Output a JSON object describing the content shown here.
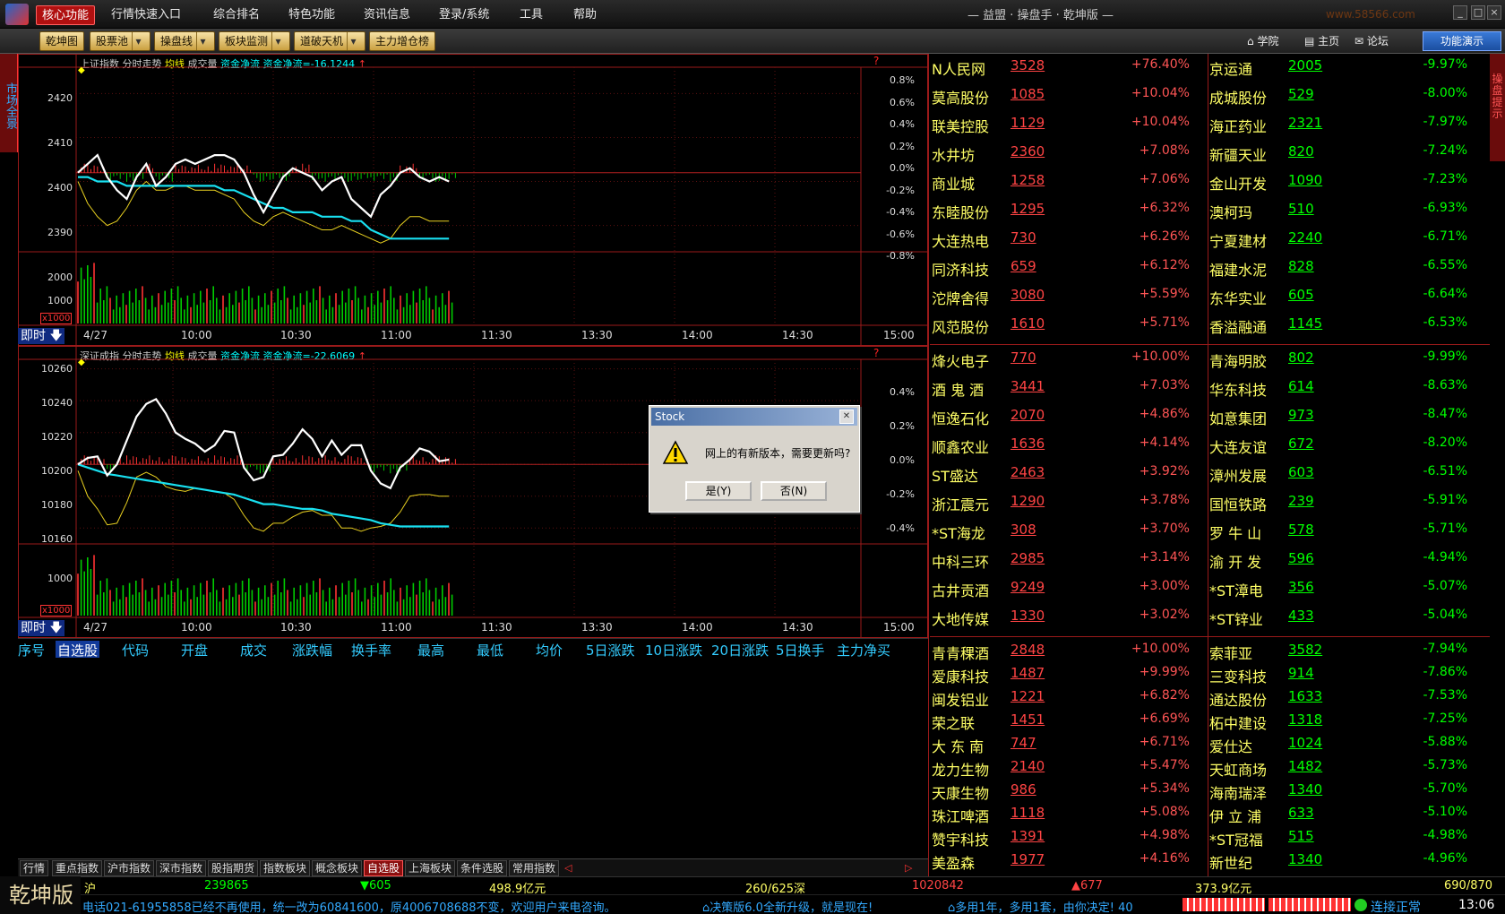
{
  "menubar": {
    "items": [
      "核心功能",
      "行情快速入口",
      "综合排名",
      "特色功能",
      "资讯信息",
      "登录/系统",
      "工具",
      "帮助"
    ],
    "brand": "— 益盟 · 操盘手 · 乾坤版 —",
    "sitemark": "www.58566.com"
  },
  "toolbar": {
    "buttons": [
      "乾坤图",
      "股票池",
      "操盘线",
      "板块监测",
      "道破天机",
      "主力增仓榜"
    ],
    "links": [
      "学院",
      "主页",
      "论坛"
    ],
    "demo": "功能演示"
  },
  "lefttab": "市场全景",
  "rightside": "操盘提示",
  "chart1": {
    "title_name": "上证指数",
    "labels": [
      "分时走势",
      "均线",
      "成交量",
      "资金净流"
    ],
    "flow": "资金净流=-16.1244",
    "yticks": [
      "2420",
      "2410",
      "2400",
      "2390"
    ],
    "pticks": [
      "0.8%",
      "0.6%",
      "0.4%",
      "0.2%",
      "0.0%",
      "-0.2%",
      "-0.4%",
      "-0.6%",
      "-0.8%"
    ],
    "vticks": [
      "2000",
      "1000"
    ],
    "unit": "x1000",
    "date": "4/27",
    "times": [
      "10:00",
      "10:30",
      "11:00",
      "11:30",
      "13:30",
      "14:00",
      "14:30",
      "15:00"
    ]
  },
  "chart2": {
    "title_name": "深证成指",
    "labels": [
      "分时走势",
      "均线",
      "成交量",
      "资金净流"
    ],
    "flow": "资金净流=-22.6069",
    "yticks": [
      "10260",
      "10240",
      "10220",
      "10200",
      "10180",
      "10160"
    ],
    "pticks": [
      "0.4%",
      "0.2%",
      "0.0%",
      "-0.2%",
      "-0.4%"
    ],
    "vticks": [
      "1000"
    ],
    "unit": "x1000",
    "date": "4/27",
    "times": [
      "10:00",
      "10:30",
      "11:00",
      "11:30",
      "13:30",
      "14:00",
      "14:30",
      "15:00"
    ]
  },
  "jishi": "即时",
  "columns": [
    "序号",
    "自选股",
    "代码",
    "开盘",
    "成交",
    "涨跌幅",
    "换手率",
    "最高",
    "最低",
    "均价",
    "5日涨跌",
    "10日涨跌",
    "20日涨跌",
    "5日换手",
    "主力净买"
  ],
  "lists": [
    [
      {
        "a": "N人民网",
        "ap": "3528",
        "ac": "+76.40%",
        "b": "京运通",
        "bp": "2005",
        "bc": "-9.97%"
      },
      {
        "a": "莫高股份",
        "ap": "1085",
        "ac": "+10.04%",
        "b": "成城股份",
        "bp": "529",
        "bc": "-8.00%"
      },
      {
        "a": "联美控股",
        "ap": "1129",
        "ac": "+10.04%",
        "b": "海正药业",
        "bp": "2321",
        "bc": "-7.97%"
      },
      {
        "a": "水井坊",
        "ap": "2360",
        "ac": "+7.08%",
        "b": "新疆天业",
        "bp": "820",
        "bc": "-7.24%"
      },
      {
        "a": "商业城",
        "ap": "1258",
        "ac": "+7.06%",
        "b": "金山开发",
        "bp": "1090",
        "bc": "-7.23%"
      },
      {
        "a": "东睦股份",
        "ap": "1295",
        "ac": "+6.32%",
        "b": "澳柯玛",
        "bp": "510",
        "bc": "-6.93%"
      },
      {
        "a": "大连热电",
        "ap": "730",
        "ac": "+6.26%",
        "b": "宁夏建材",
        "bp": "2240",
        "bc": "-6.71%"
      },
      {
        "a": "同济科技",
        "ap": "659",
        "ac": "+6.12%",
        "b": "福建水泥",
        "bp": "828",
        "bc": "-6.55%"
      },
      {
        "a": "沱牌舍得",
        "ap": "3080",
        "ac": "+5.59%",
        "b": "东华实业",
        "bp": "605",
        "bc": "-6.64%"
      },
      {
        "a": "风范股份",
        "ap": "1610",
        "ac": "+5.71%",
        "b": "香溢融通",
        "bp": "1145",
        "bc": "-6.53%"
      }
    ],
    [
      {
        "a": "烽火电子",
        "ap": "770",
        "ac": "+10.00%",
        "b": "青海明胶",
        "bp": "802",
        "bc": "-9.99%"
      },
      {
        "a": "酒 鬼 酒",
        "ap": "3441",
        "ac": "+7.03%",
        "b": "华东科技",
        "bp": "614",
        "bc": "-8.63%"
      },
      {
        "a": "恒逸石化",
        "ap": "2070",
        "ac": "+4.86%",
        "b": "如意集团",
        "bp": "973",
        "bc": "-8.47%"
      },
      {
        "a": "顺鑫农业",
        "ap": "1636",
        "ac": "+4.14%",
        "b": "大连友谊",
        "bp": "672",
        "bc": "-8.20%"
      },
      {
        "a": "ST盛达",
        "ap": "2463",
        "ac": "+3.92%",
        "b": "漳州发展",
        "bp": "603",
        "bc": "-6.51%"
      },
      {
        "a": "浙江震元",
        "ap": "1290",
        "ac": "+3.78%",
        "b": "国恒铁路",
        "bp": "239",
        "bc": "-5.91%"
      },
      {
        "a": "*ST海龙",
        "ap": "308",
        "ac": "+3.70%",
        "b": "罗 牛 山",
        "bp": "578",
        "bc": "-5.71%"
      },
      {
        "a": "中科三环",
        "ap": "2985",
        "ac": "+3.14%",
        "b": "渝 开 发",
        "bp": "596",
        "bc": "-4.94%"
      },
      {
        "a": "古井贡酒",
        "ap": "9249",
        "ac": "+3.00%",
        "b": "*ST漳电",
        "bp": "356",
        "bc": "-5.07%"
      },
      {
        "a": "大地传媒",
        "ap": "1330",
        "ac": "+3.02%",
        "b": "*ST锌业",
        "bp": "433",
        "bc": "-5.04%"
      }
    ],
    [
      {
        "a": "青青稞酒",
        "ap": "2848",
        "ac": "+10.00%",
        "b": "索菲亚",
        "bp": "3582",
        "bc": "-7.94%"
      },
      {
        "a": "爱康科技",
        "ap": "1487",
        "ac": "+9.99%",
        "b": "三变科技",
        "bp": "914",
        "bc": "-7.86%"
      },
      {
        "a": "闽发铝业",
        "ap": "1221",
        "ac": "+6.82%",
        "b": "通达股份",
        "bp": "1633",
        "bc": "-7.53%"
      },
      {
        "a": "荣之联",
        "ap": "1451",
        "ac": "+6.69%",
        "b": "柘中建设",
        "bp": "1318",
        "bc": "-7.25%"
      },
      {
        "a": "大 东 南",
        "ap": "747",
        "ac": "+6.71%",
        "b": "爱仕达",
        "bp": "1024",
        "bc": "-5.88%"
      },
      {
        "a": "龙力生物",
        "ap": "2140",
        "ac": "+5.47%",
        "b": "天虹商场",
        "bp": "1482",
        "bc": "-5.73%"
      },
      {
        "a": "天康生物",
        "ap": "986",
        "ac": "+5.34%",
        "b": "海南瑞泽",
        "bp": "1340",
        "bc": "-5.70%"
      },
      {
        "a": "珠江啤酒",
        "ap": "1118",
        "ac": "+5.08%",
        "b": "伊 立 浦",
        "bp": "633",
        "bc": "-5.10%"
      },
      {
        "a": "赞宇科技",
        "ap": "1391",
        "ac": "+4.98%",
        "b": "*ST冠福",
        "bp": "515",
        "bc": "-4.98%"
      },
      {
        "a": "美盈森",
        "ap": "1977",
        "ac": "+4.16%",
        "b": "新世纪",
        "bp": "1340",
        "bc": "-4.96%"
      }
    ]
  ],
  "btabs": [
    "行情",
    "重点指数",
    "沪市指数",
    "深市指数",
    "股指期货",
    "指数板块",
    "概念板块",
    "自选股",
    "上海板块",
    "条件选股",
    "常用指数"
  ],
  "status": {
    "brand": "乾坤版",
    "sh_label": "沪",
    "sh_index": "239865",
    "sh_change": "▼605",
    "sh_amount": "498.9亿元",
    "sh_ratio": "260/625深",
    "sz_index": "1020842",
    "sz_change": "▲677",
    "sz_amount": "373.9亿元",
    "sz_ratio": "690/870",
    "ticker": "电话021-61955858已经不再使用，统一改为60841600，原4006708688不变，欢迎用户来电咨询。",
    "ticker2": "决策版6.0全新升级，就是现在!",
    "ticker3": "多用1年，多用1套，由你决定! 40",
    "conn": "连接正常",
    "time": "13:06"
  },
  "dialog": {
    "title": "Stock",
    "message": "网上的有新版本，需要更新吗?",
    "yes": "是(Y)",
    "no": "否(N)"
  },
  "chart_data": [
    {
      "type": "line",
      "title": "上证指数",
      "yticks": [
        2420,
        2410,
        2400,
        2390
      ],
      "ylim": [
        2384,
        2426
      ],
      "price": [
        2402,
        2404,
        2406,
        2401,
        2398,
        2396,
        2401,
        2404,
        2399,
        2401,
        2404,
        2405,
        2404,
        2405,
        2406,
        2406,
        2405,
        2402,
        2397,
        2393,
        2397,
        2401,
        2403,
        2402,
        2401,
        2398,
        2400,
        2401,
        2396,
        2394,
        2392,
        2397,
        2399,
        2402,
        2403,
        2401,
        2400,
        2401,
        2400
      ],
      "avg": [
        2401,
        2401,
        2400,
        2400,
        2400,
        2399,
        2399,
        2399,
        2399,
        2399,
        2399,
        2399,
        2399,
        2399,
        2399,
        2398,
        2398,
        2397,
        2396,
        2395,
        2394,
        2394,
        2393,
        2393,
        2393,
        2392,
        2392,
        2392,
        2391,
        2391,
        2389,
        2388,
        2387,
        2387,
        2387,
        2387,
        2387,
        2387,
        2387
      ],
      "flow": [
        2400,
        2395,
        2392,
        2390,
        2391,
        2394,
        2398,
        2400,
        2398,
        2398,
        2399,
        2399,
        2398,
        2398,
        2398,
        2397,
        2396,
        2393,
        2391,
        2390,
        2392,
        2393,
        2392,
        2391,
        2390,
        2389,
        2389,
        2390,
        2389,
        2388,
        2387,
        2386,
        2387,
        2390,
        2392,
        2392,
        2391,
        2391,
        2391
      ]
    },
    {
      "type": "line",
      "title": "深证成指",
      "yticks": [
        10260,
        10240,
        10220,
        10200,
        10180,
        10160
      ],
      "ylim": [
        10150,
        10266
      ],
      "price": [
        10200,
        10204,
        10205,
        10193,
        10200,
        10215,
        10230,
        10238,
        10241,
        10232,
        10220,
        10216,
        10213,
        10208,
        10212,
        10221,
        10220,
        10198,
        10190,
        10192,
        10205,
        10206,
        10213,
        10222,
        10216,
        10205,
        10215,
        10206,
        10212,
        10212,
        10196,
        10188,
        10185,
        10198,
        10203,
        10210,
        10208,
        10202,
        10203
      ],
      "avg": [
        10200,
        10198,
        10196,
        10194,
        10193,
        10192,
        10191,
        10190,
        10189,
        10188,
        10187,
        10186,
        10185,
        10184,
        10183,
        10182,
        10181,
        10179,
        10177,
        10175,
        10175,
        10174,
        10173,
        10172,
        10172,
        10171,
        10169,
        10168,
        10167,
        10166,
        10165,
        10163,
        10162,
        10161,
        10161,
        10161,
        10161,
        10161,
        10161
      ],
      "flow": [
        10196,
        10180,
        10172,
        10162,
        10163,
        10176,
        10192,
        10195,
        10192,
        10186,
        10184,
        10183,
        10185,
        10184,
        10183,
        10182,
        10178,
        10168,
        10160,
        10158,
        10163,
        10163,
        10167,
        10170,
        10171,
        10168,
        10168,
        10160,
        10160,
        10158,
        10160,
        10161,
        10163,
        10170,
        10180,
        10181,
        10181,
        10180,
        10180
      ]
    }
  ]
}
